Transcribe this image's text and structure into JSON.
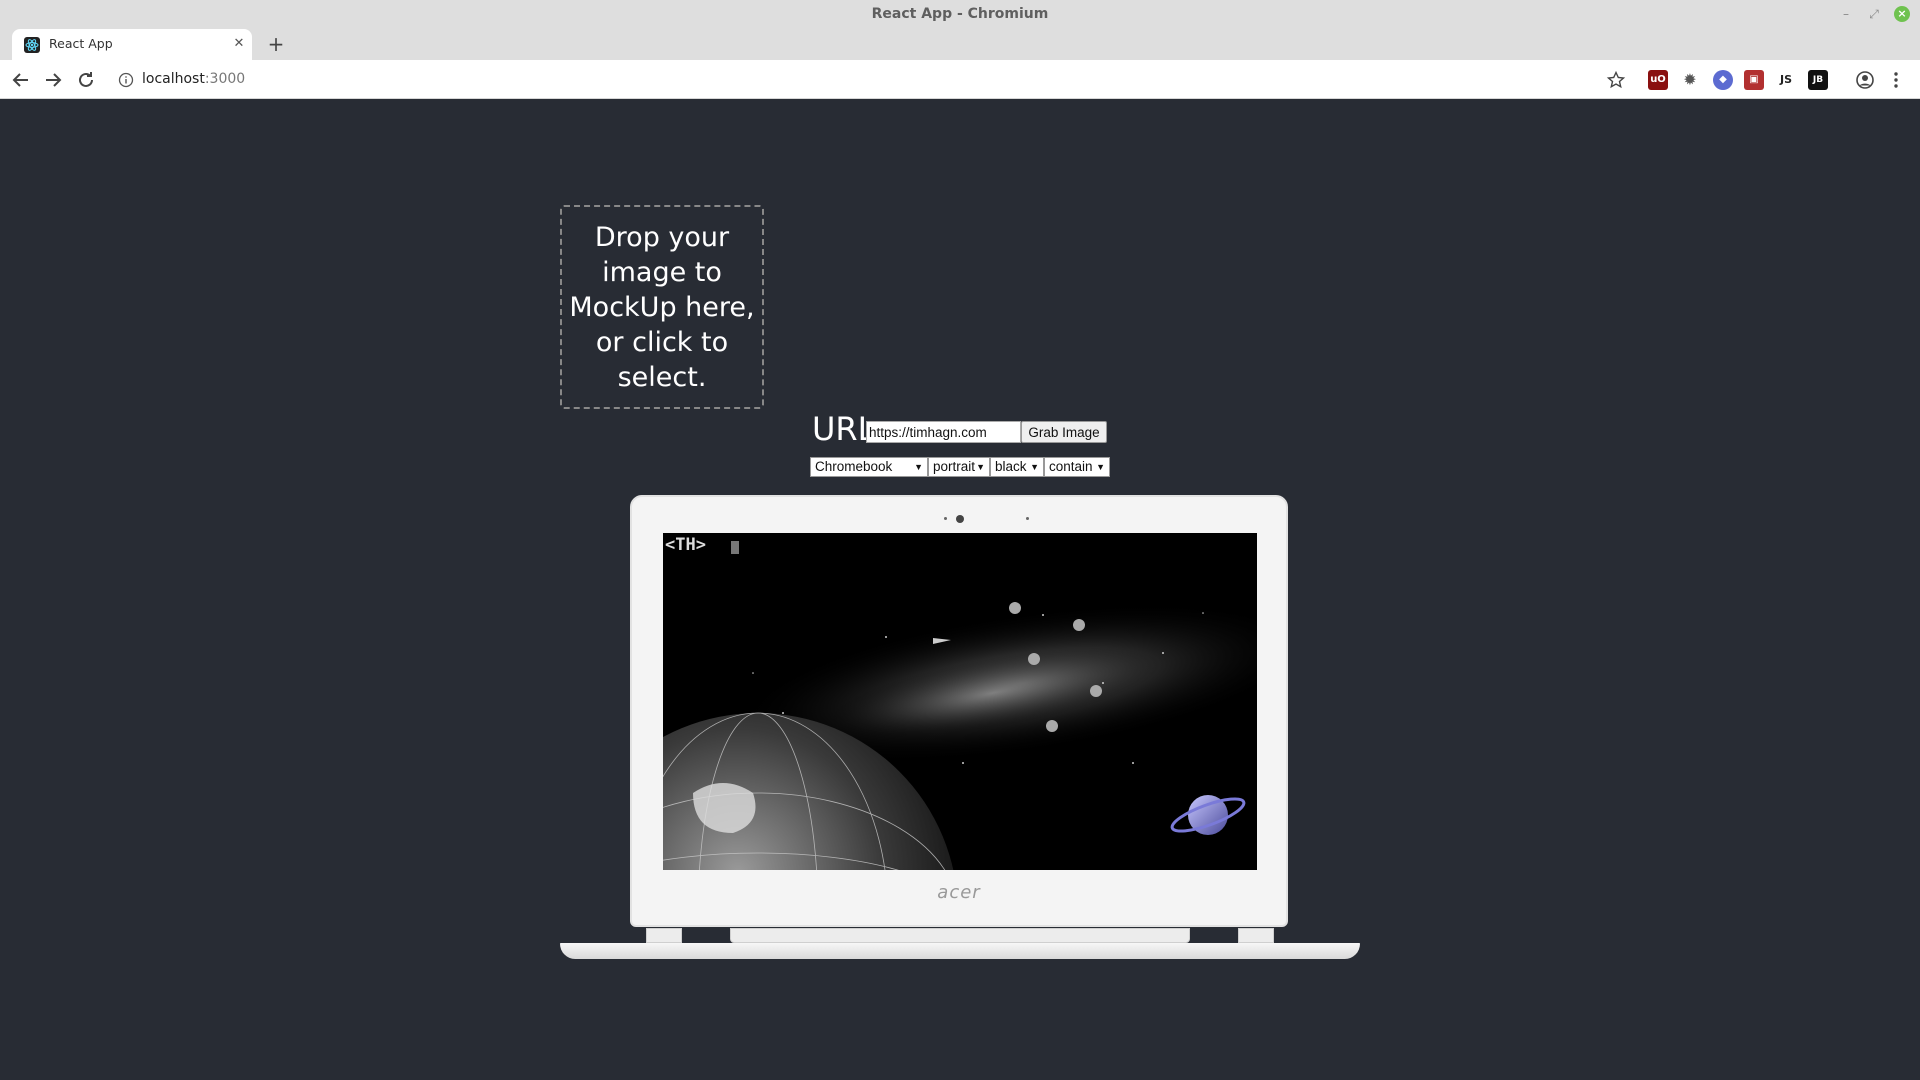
{
  "window": {
    "title": "React App - Chromium"
  },
  "tabs": [
    {
      "title": "React App"
    }
  ],
  "address": {
    "host": "localhost",
    "port": ":3000"
  },
  "extensions": [
    "uBlock",
    "gear",
    "shield",
    "ext",
    "JS",
    "JB"
  ],
  "app": {
    "dropzone_text": "Drop your image to MockUp here, or click to select.",
    "url_label": "URL",
    "url_value": "https://timhagn.com",
    "grab_button": "Grab Image",
    "device": "Chromebook",
    "orientation": "portrait",
    "color": "black",
    "fit": "contain"
  },
  "mockup": {
    "brand": "acer",
    "site_logo": "<TH>"
  }
}
